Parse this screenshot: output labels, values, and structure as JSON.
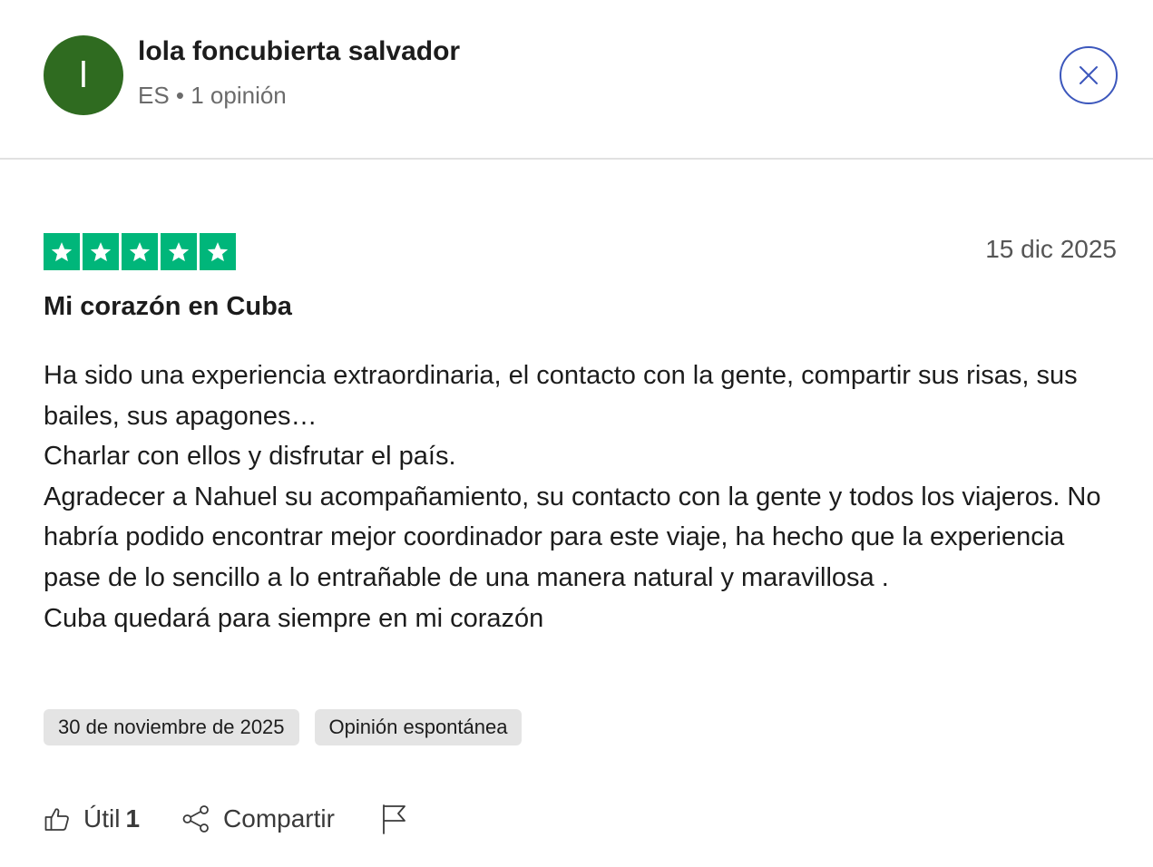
{
  "header": {
    "avatar_initial": "l",
    "user_name": "lola foncubierta salvador",
    "user_meta": "ES • 1 opinión",
    "close_icon": "close-icon"
  },
  "review": {
    "rating": 5,
    "star_color": "#00b67a",
    "date": "15 dic 2025",
    "title": "Mi corazón en Cuba",
    "paragraphs": [
      "Ha sido una experiencia extraordinaria, el contacto con la gente, compartir sus risas, sus bailes, sus apagones…",
      "Charlar con ellos y disfrutar el país.",
      "Agradecer a Nahuel su acompañamiento, su contacto con la gente y todos los viajeros. No habría podido encontrar mejor coordinador para este viaje, ha hecho que la experiencia pase de lo sencillo a lo entrañable de una manera natural y maravillosa .",
      "Cuba quedará para siempre en mi corazón"
    ],
    "tags": [
      "30 de noviembre de 2025",
      "Opinión espontánea"
    ]
  },
  "actions": {
    "useful_label": "Útil",
    "useful_count": "1",
    "share_label": "Compartir",
    "flag_icon": "flag-icon"
  },
  "colors": {
    "avatar_bg": "#2f6b20",
    "close_border": "#3c57bc",
    "tag_bg": "#e4e4e4"
  }
}
